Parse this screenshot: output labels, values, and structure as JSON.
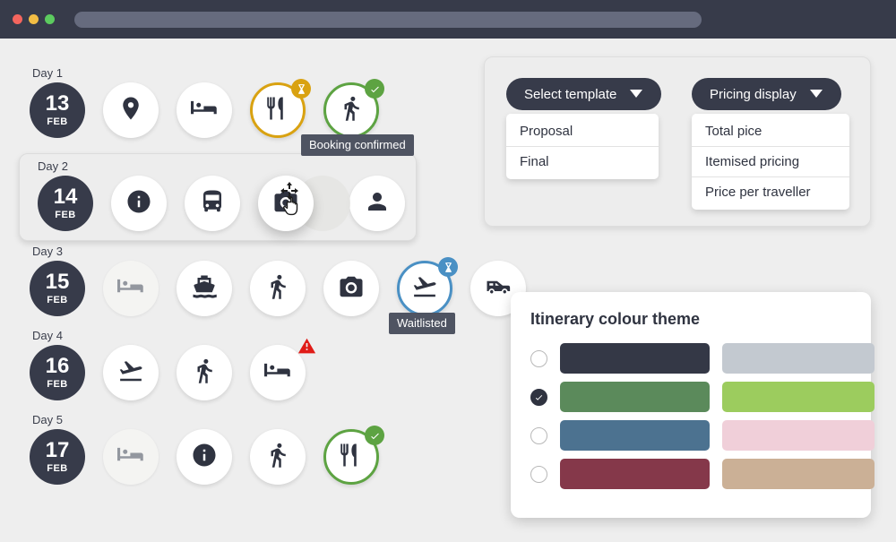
{
  "window": {
    "traffic_lights": [
      "close",
      "minimize",
      "maximize"
    ],
    "address_value": "",
    "chrome_color": "#373b4a"
  },
  "itinerary": {
    "days": [
      {
        "label": "Day 1",
        "date_day": "13",
        "date_month": "FEB",
        "selected": false,
        "items": [
          {
            "icon": "location-pin-icon",
            "state": "normal",
            "badge": null
          },
          {
            "icon": "hotel-bed-icon",
            "state": "normal",
            "badge": null
          },
          {
            "icon": "restaurant-cutlery-icon",
            "state": "pending",
            "badge": "hourglass"
          },
          {
            "icon": "walking-tour-icon",
            "state": "confirmed",
            "badge": "check",
            "tooltip": "Booking confirmed"
          }
        ]
      },
      {
        "label": "Day 2",
        "date_day": "14",
        "date_month": "FEB",
        "selected": true,
        "items": [
          {
            "icon": "information-icon",
            "state": "normal",
            "badge": null
          },
          {
            "icon": "bus-icon",
            "state": "normal",
            "badge": null
          },
          {
            "icon": "camera-sightseeing-icon",
            "state": "dragging",
            "badge": null
          },
          {
            "icon": "guide-person-icon",
            "state": "normal",
            "badge": null
          }
        ]
      },
      {
        "label": "Day 3",
        "date_day": "15",
        "date_month": "FEB",
        "selected": false,
        "items": [
          {
            "icon": "hotel-bed-icon",
            "state": "disabled",
            "badge": null
          },
          {
            "icon": "ferry-boat-icon",
            "state": "normal",
            "badge": null
          },
          {
            "icon": "walking-tour-icon",
            "state": "normal",
            "badge": null
          },
          {
            "icon": "camera-sightseeing-icon",
            "state": "normal",
            "badge": null
          },
          {
            "icon": "flight-departure-icon",
            "state": "waitlisted",
            "badge": "hourglass",
            "tooltip": "Waitlisted"
          },
          {
            "icon": "van-transfer-icon",
            "state": "normal",
            "badge": null
          }
        ]
      },
      {
        "label": "Day 4",
        "date_day": "16",
        "date_month": "FEB",
        "selected": false,
        "items": [
          {
            "icon": "flight-departure-icon",
            "state": "normal",
            "badge": null
          },
          {
            "icon": "walking-tour-icon",
            "state": "normal",
            "badge": null
          },
          {
            "icon": "hotel-bed-icon",
            "state": "normal",
            "badge": "warning"
          }
        ]
      },
      {
        "label": "Day 5",
        "date_day": "17",
        "date_month": "FEB",
        "selected": false,
        "items": [
          {
            "icon": "hotel-bed-icon",
            "state": "disabled",
            "badge": null
          },
          {
            "icon": "information-icon",
            "state": "normal",
            "badge": null
          },
          {
            "icon": "walking-tour-icon",
            "state": "normal",
            "badge": null
          },
          {
            "icon": "restaurant-cutlery-icon",
            "state": "confirmed",
            "badge": "check"
          }
        ]
      }
    ],
    "tooltips": {
      "booking_confirmed": "Booking confirmed",
      "waitlisted": "Waitlisted"
    }
  },
  "controls_panel": {
    "template_dropdown": {
      "label": "Select template",
      "options": [
        "Proposal",
        "Final"
      ]
    },
    "pricing_dropdown": {
      "label": "Pricing display",
      "options": [
        "Total pice",
        "Itemised pricing",
        "Price per traveller"
      ]
    }
  },
  "theme_panel": {
    "title": "Itinerary colour theme",
    "themes": [
      {
        "selected": false,
        "primary": "#343846",
        "secondary": "#c3c9d0"
      },
      {
        "selected": true,
        "primary": "#5b8a5b",
        "secondary": "#9ccc5e"
      },
      {
        "selected": false,
        "primary": "#4c7290",
        "secondary": "#f0cfd9"
      },
      {
        "selected": false,
        "primary": "#85384a",
        "secondary": "#cbb096"
      }
    ]
  },
  "status_colors": {
    "pending": "#d9a211",
    "confirmed": "#5da342",
    "waitlisted": "#4a90c4",
    "warning": "#e01b17"
  }
}
